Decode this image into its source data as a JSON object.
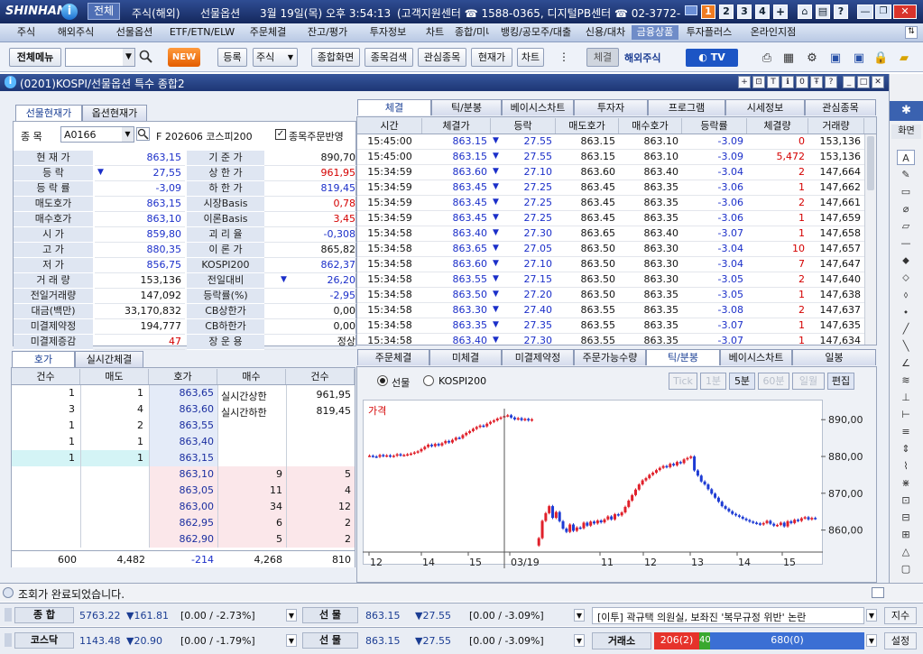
{
  "titlebar": {
    "brand": "SHINHAN",
    "menu_all": "전체",
    "tabs": [
      "주식(해외)",
      "선물옵션"
    ],
    "date": "3월 19일(목) 오후 3:54:13",
    "support": "(고객지원센터 ☎ 1588-0365, 디지털PB센터 ☎ 02-3772-",
    "window_nums": [
      "1",
      "2",
      "3",
      "4"
    ]
  },
  "menu": {
    "items": [
      "주식",
      "해외주식",
      "선물옵션",
      "ETF/ETN/ELW",
      "주문체결",
      "잔고/평가",
      "투자정보",
      "차트",
      "종합/미니",
      "뱅킹/공모주/대출",
      "신용/대차",
      "금융상품",
      "투자플러스",
      "온라인지점"
    ]
  },
  "toolbar": {
    "all_menu": "전체메뉴",
    "new": "NEW",
    "register": "등록",
    "stock": "주식",
    "buttons": [
      "종합화면",
      "종목검색",
      "관심종목",
      "현재가",
      "차트"
    ],
    "contract": "체결",
    "overseas": "해외주식",
    "tv": "TV"
  },
  "window": {
    "title": "(0201)KOSPI/선물옵션 특수 종합2"
  },
  "left": {
    "tabs": [
      "선물현재가",
      "옵션현재가"
    ],
    "code_label": "종 목",
    "code": "A0166",
    "name": "F 202606 코스피200",
    "checkbox": "종목주문반영",
    "rows": [
      {
        "l1": "현 재 가",
        "v1": "863,15",
        "c1": "blue",
        "l2": "기 준 가",
        "v2": "890,70",
        "c2": "black"
      },
      {
        "l1": "등 락",
        "v1": "27,55",
        "c1": "blue",
        "arrow": "▼",
        "l2": "상 한 가",
        "v2": "961,95",
        "c2": "red"
      },
      {
        "l1": "등 락 률",
        "v1": "-3,09",
        "c1": "blue",
        "l2": "하 한 가",
        "v2": "819,45",
        "c2": "blue"
      },
      {
        "l1": "매도호가",
        "v1": "863,15",
        "c1": "blue",
        "l2": "시장Basis",
        "v2": "0,78",
        "c2": "red"
      },
      {
        "l1": "매수호가",
        "v1": "863,10",
        "c1": "blue",
        "l2": "이론Basis",
        "v2": "3,45",
        "c2": "red"
      },
      {
        "l1": "시 가",
        "v1": "859,80",
        "c1": "blue",
        "l2": "괴 리 율",
        "v2": "-0,308",
        "c2": "blue"
      },
      {
        "l1": "고 가",
        "v1": "880,35",
        "c1": "blue",
        "l2": "이 론 가",
        "v2": "865,82",
        "c2": "black"
      },
      {
        "l1": "저 가",
        "v1": "856,75",
        "c1": "blue",
        "l2": "KOSPI200",
        "v2": "862,37",
        "c2": "blue"
      },
      {
        "l1": "거 래 량",
        "v1": "153,136",
        "c1": "black",
        "l2": "전일대비",
        "v2": "26,20",
        "c2": "blue",
        "arrow2": "▼"
      },
      {
        "l1": "전일거래량",
        "v1": "147,092",
        "c1": "black",
        "l2": "등락률(%)",
        "v2": "-2,95",
        "c2": "blue"
      },
      {
        "l1": "대금(백만)",
        "v1": "33,170,832",
        "c1": "black",
        "l2": "CB상한가",
        "v2": "0,00",
        "c2": "black"
      },
      {
        "l1": "미결제약정",
        "v1": "194,777",
        "c1": "black",
        "l2": "CB하한가",
        "v2": "0,00",
        "c2": "black"
      },
      {
        "l1": "미결제증감",
        "v1": "47",
        "c1": "red",
        "l2": "장 운 용",
        "v2": "정상",
        "c2": "black"
      }
    ]
  },
  "hoga": {
    "tabs": [
      "호가",
      "실시간체결"
    ],
    "headers": [
      "건수",
      "매도",
      "호가",
      "매수",
      "건수"
    ],
    "sell": [
      {
        "cnt": "1",
        "qty": "1",
        "price": "863,65"
      },
      {
        "cnt": "3",
        "qty": "4",
        "price": "863,60"
      },
      {
        "cnt": "1",
        "qty": "2",
        "price": "863,55"
      },
      {
        "cnt": "1",
        "qty": "1",
        "price": "863,40"
      },
      {
        "cnt": "1",
        "qty": "1",
        "price": "863,15"
      }
    ],
    "buy": [
      {
        "price": "863,10",
        "qty": "9",
        "cnt": "5"
      },
      {
        "price": "863,05",
        "qty": "11",
        "cnt": "4"
      },
      {
        "price": "863,00",
        "qty": "34",
        "cnt": "12"
      },
      {
        "price": "862,95",
        "qty": "6",
        "cnt": "2"
      },
      {
        "price": "862,90",
        "qty": "5",
        "cnt": "2"
      }
    ],
    "info": [
      {
        "label": "실시간상한",
        "value": "961,95"
      },
      {
        "label": "실시간하한",
        "value": "819,45"
      }
    ],
    "totals": [
      "600",
      "4,482",
      "-214",
      "4,268",
      "810"
    ]
  },
  "trades": {
    "tabs": [
      "체결",
      "틱/분봉",
      "베이시스차트",
      "투자자",
      "프로그램",
      "시세정보",
      "관심종목"
    ],
    "headers": [
      "시간",
      "체결가",
      "등락",
      "매도호가",
      "매수호가",
      "등락률",
      "체결량",
      "거래량"
    ],
    "rows": [
      [
        "15:45:00",
        "863.15",
        "27.55",
        "863.15",
        "863.10",
        "-3.09",
        "0",
        "153,136"
      ],
      [
        "15:45:00",
        "863.15",
        "27.55",
        "863.15",
        "863.10",
        "-3.09",
        "5,472",
        "153,136"
      ],
      [
        "15:34:59",
        "863.60",
        "27.10",
        "863.60",
        "863.40",
        "-3.04",
        "2",
        "147,664"
      ],
      [
        "15:34:59",
        "863.45",
        "27.25",
        "863.45",
        "863.35",
        "-3.06",
        "1",
        "147,662"
      ],
      [
        "15:34:59",
        "863.45",
        "27.25",
        "863.45",
        "863.35",
        "-3.06",
        "2",
        "147,661"
      ],
      [
        "15:34:59",
        "863.45",
        "27.25",
        "863.45",
        "863.35",
        "-3.06",
        "1",
        "147,659"
      ],
      [
        "15:34:58",
        "863.40",
        "27.30",
        "863.65",
        "863.40",
        "-3.07",
        "1",
        "147,658"
      ],
      [
        "15:34:58",
        "863.65",
        "27.05",
        "863.50",
        "863.30",
        "-3.04",
        "10",
        "147,657"
      ],
      [
        "15:34:58",
        "863.60",
        "27.10",
        "863.50",
        "863.30",
        "-3.04",
        "7",
        "147,647"
      ],
      [
        "15:34:58",
        "863.55",
        "27.15",
        "863.50",
        "863.30",
        "-3.05",
        "2",
        "147,640"
      ],
      [
        "15:34:58",
        "863.50",
        "27.20",
        "863.50",
        "863.35",
        "-3.05",
        "1",
        "147,638"
      ],
      [
        "15:34:58",
        "863.30",
        "27.40",
        "863.55",
        "863.35",
        "-3.08",
        "2",
        "147,637"
      ],
      [
        "15:34:58",
        "863.35",
        "27.35",
        "863.55",
        "863.35",
        "-3.07",
        "1",
        "147,635"
      ],
      [
        "15:34:58",
        "863.40",
        "27.30",
        "863.55",
        "863.35",
        "-3.07",
        "1",
        "147,634"
      ]
    ]
  },
  "chartpanel": {
    "tabs": [
      "주문체결",
      "미체결",
      "미결제약정",
      "주문가능수량",
      "틱/분봉",
      "베이시스차트",
      "일봉"
    ],
    "radio": [
      "선물",
      "KOSPI200"
    ],
    "buttons": [
      "Tick",
      "1분",
      "5분",
      "60분",
      "일월",
      "편집"
    ],
    "legend": "가격"
  },
  "chart_data": {
    "type": "candlestick",
    "title": "가격",
    "yticks": [
      "890,00",
      "880,00",
      "870,00",
      "860,00"
    ],
    "ylim": [
      855,
      893
    ],
    "xticks": [
      "12",
      "14",
      "15",
      "03/19",
      "11",
      "12",
      "13",
      "14",
      "15"
    ],
    "values": [
      880.2,
      880.0,
      879.9,
      880.4,
      880.1,
      880.3,
      880.0,
      880.2,
      880.6,
      880.3,
      880.4,
      880.6,
      880.8,
      881.1,
      881.4,
      882.0,
      882.6,
      883.2,
      882.8,
      883.4,
      883.0,
      883.6,
      884.2,
      883.8,
      884.5,
      885.1,
      885.0,
      885.8,
      886.4,
      886.9,
      887.5,
      888.0,
      888.4,
      888.2,
      888.9,
      889.4,
      889.8,
      890.3,
      890.6,
      891.0,
      891.2,
      890.6,
      890.1,
      890.4,
      889.9,
      890.2,
      889.8,
      890.1,
      null,
      857.8,
      862.5,
      864.6,
      866.5,
      863.3,
      864.9,
      862.4,
      860.4,
      859.5,
      861.5,
      859.8,
      860.7,
      860.5,
      862.0,
      861.2,
      862.3,
      861.8,
      862.6,
      862.1,
      862.9,
      863.7,
      862.9,
      864.3,
      864.0,
      864.8,
      866.3,
      868.0,
      869.5,
      871.0,
      872.4,
      873.5,
      874.1,
      875.0,
      875.6,
      876.3,
      876.9,
      877.4,
      877.1,
      878.0,
      877.6,
      878.5,
      878.2,
      879.2,
      879.6,
      880.0,
      876.2,
      874.8,
      873.2,
      872.4,
      871.1,
      869.9,
      868.8,
      867.7,
      866.5,
      865.8,
      865.1,
      864.4,
      864.0,
      863.6,
      863.1,
      862.7,
      862.3,
      862.0,
      861.8,
      861.5,
      861.9,
      862.5,
      861.7,
      861.2,
      861.4,
      862.0,
      861.0,
      862.4,
      861.9,
      862.8,
      862.5,
      863.2,
      863.5,
      862.9,
      863.3,
      863.1
    ]
  },
  "status": {
    "message": "조회가 완료되었습니다."
  },
  "ticker1": {
    "l1": "종 합",
    "v1": "5763.22",
    "d1": "▼161.81",
    "p1": "[0.00 / -2.73%]",
    "l2": "선 물",
    "v2": "863.15",
    "d2": "▼27.55",
    "p2": "[0.00 / -3.09%]",
    "news": "[이투] 곽규택 의원실, 보좌진 '복무규정 위반' 논란",
    "btn": "지수"
  },
  "ticker2": {
    "l1": "코스닥",
    "v1": "1143.48",
    "d1": "▼20.90",
    "p1": "[0.00 / -1.79%]",
    "l2": "선 물",
    "v2": "863.15",
    "d2": "▼27.55",
    "p2": "[0.00 / -3.09%]",
    "exch": "거래소",
    "n_down": "206(2)",
    "n_mid": "40",
    "n_up": "680(0)",
    "btn": "설정"
  }
}
